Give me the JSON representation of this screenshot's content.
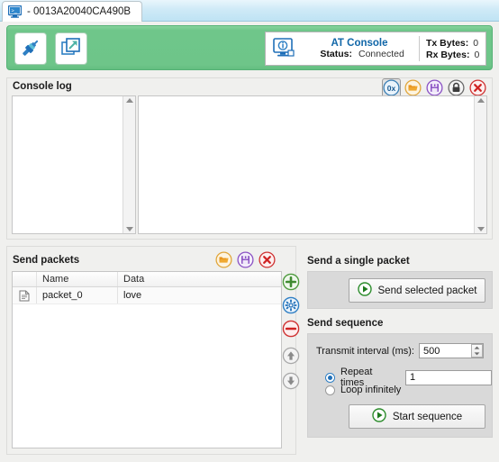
{
  "tab": {
    "icon": "console-monitor-icon",
    "title": "- 0013A20040CA490B"
  },
  "toolbar": {
    "disconnect_icon": "plug-connector-icon",
    "detach_icon": "window-popout-icon"
  },
  "status": {
    "icon": "info-monitor-icon",
    "title": "AT Console",
    "status_label": "Status:",
    "status_value": "Connected",
    "tx_label": "Tx Bytes:",
    "tx_value": "0",
    "rx_label": "Rx Bytes:",
    "rx_value": "0",
    "title_color": "#1066a8"
  },
  "console_log": {
    "title": "Console log",
    "left_text": "",
    "right_text": "",
    "tools": [
      {
        "name": "hex-view-toggle",
        "label": "0x",
        "selected": true
      },
      {
        "name": "open-log-icon",
        "label": "",
        "selected": false
      },
      {
        "name": "save-log-icon",
        "label": "",
        "selected": false
      },
      {
        "name": "lock-scroll-icon",
        "label": "",
        "selected": false
      },
      {
        "name": "clear-log-icon",
        "label": "",
        "selected": false
      }
    ]
  },
  "send_packets": {
    "title": "Send packets",
    "tools": [
      {
        "name": "open-packets-icon"
      },
      {
        "name": "save-packets-icon"
      },
      {
        "name": "delete-packets-icon"
      }
    ],
    "columns": [
      "",
      "Name",
      "Data"
    ],
    "rows": [
      {
        "icon": "packet-file-icon",
        "name": "packet_0",
        "data": "love"
      }
    ],
    "side_buttons": [
      {
        "name": "add-packet-button"
      },
      {
        "name": "edit-packet-button"
      },
      {
        "name": "remove-packet-button"
      },
      {
        "name": "move-up-button"
      },
      {
        "name": "move-down-button"
      }
    ]
  },
  "single_packet": {
    "title": "Send a single packet",
    "send_button": "Send selected packet"
  },
  "sequence": {
    "title": "Send sequence",
    "interval_label": "Transmit interval (ms):",
    "interval_value": "500",
    "repeat_label": "Repeat times",
    "repeat_value": "1",
    "repeat_selected": true,
    "loop_label": "Loop infinitely",
    "loop_selected": false,
    "start_button": "Start sequence"
  },
  "colors": {
    "green_bar": "#6ec589",
    "accent_blue": "#1066a8",
    "panel_gray": "#d9d9d9"
  }
}
